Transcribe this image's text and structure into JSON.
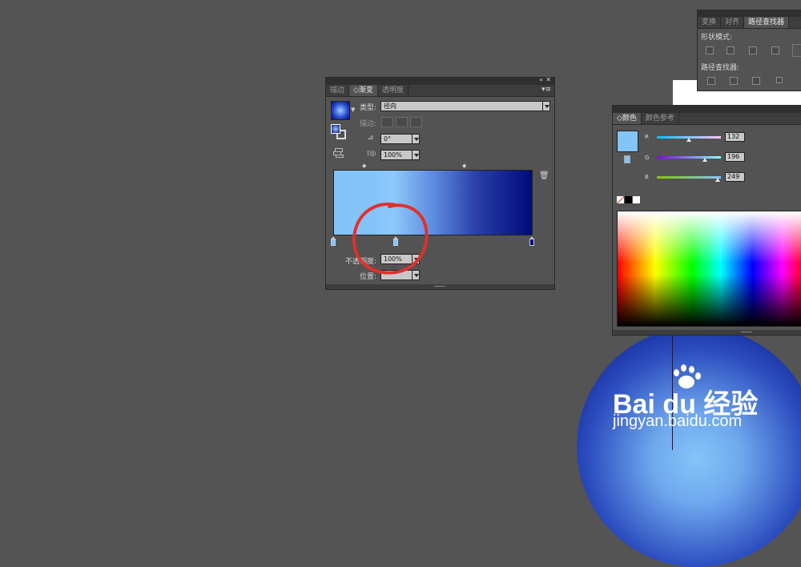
{
  "gradient_panel": {
    "tabs": [
      {
        "label": "描边",
        "active": false
      },
      {
        "label": "◇渐变",
        "active": true
      },
      {
        "label": "透明度",
        "active": false
      }
    ],
    "type_label": "类型:",
    "type_value": "径向",
    "stroke_label": "描边:",
    "angle_value": "0°",
    "aspect_value": "100%",
    "opacity_label": "不透明度:",
    "opacity_value": "100%",
    "position_label": "位置:",
    "position_value": "",
    "colors": {
      "start": "#84c4f9",
      "end": "#000a7c"
    }
  },
  "color_panel": {
    "tabs": [
      {
        "label": "◇颜色",
        "active": true
      },
      {
        "label": "颜色参考",
        "active": false
      }
    ],
    "r_label": "R",
    "r_value": "132",
    "g_label": "G",
    "g_value": "196",
    "b_label": "B",
    "b_value": "249",
    "swatch_color": "#84c4f9"
  },
  "pathfinder_panel": {
    "tabs": [
      {
        "label": "变换",
        "active": false
      },
      {
        "label": "对齐",
        "active": false
      },
      {
        "label": "路径查找器",
        "active": true
      }
    ],
    "shape_modes_label": "形状模式:",
    "pathfinders_label": "路径查找器:"
  },
  "watermark": {
    "brand": "Bai du 经验",
    "url": "jingyan.baidu.com"
  }
}
